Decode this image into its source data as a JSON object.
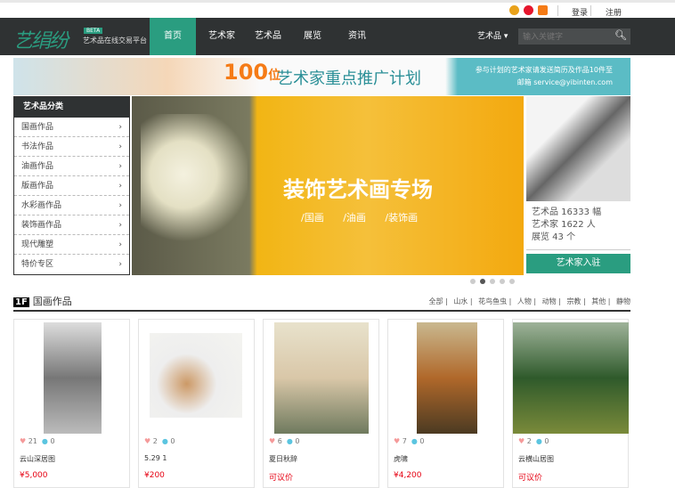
{
  "topbar": {
    "login": "登录",
    "register": "注册",
    "icons": [
      "qq-icon",
      "weibo-icon",
      "alipay-icon"
    ]
  },
  "nav": {
    "logo": "艺绢纷",
    "beta": "BETA",
    "slogan": "艺术品在线交易平台",
    "items": [
      "首页",
      "艺术家",
      "艺术品",
      "展览",
      "资讯"
    ],
    "search_type": "艺术品",
    "search_placeholder": "输入关键字"
  },
  "banner": {
    "num": "100",
    "unit": "位",
    "title": "艺术家重点推广计划",
    "line1": "参与计划的艺术家请发送简历及作品10件至",
    "line2": "邮箱 service@yibinten.com"
  },
  "categories": {
    "title": "艺术品分类",
    "items": [
      "国画作品",
      "书法作品",
      "油画作品",
      "版画作品",
      "水彩画作品",
      "装饰画作品",
      "现代雕塑",
      "特价专区"
    ]
  },
  "slider": {
    "title": "装饰艺术画专场",
    "tags": "/国画 /油画 /装饰画",
    "slides": 5,
    "active": 2
  },
  "stats": {
    "artworks": "艺术品 16333 幅",
    "artists": "艺术家 1622 人",
    "exhibitions": "展览 43 个",
    "join": "艺术家入驻"
  },
  "floor": {
    "badge": "1F",
    "title": "国画作品",
    "tabs": [
      "全部",
      "山水",
      "花鸟鱼虫",
      "人物",
      "动物",
      "宗教",
      "其他",
      "静物"
    ]
  },
  "products": [
    {
      "likes": "21",
      "comments": "0",
      "name": "云山深居图",
      "price": "¥5,000"
    },
    {
      "likes": "2",
      "comments": "0",
      "name": "5.29  1",
      "price": "¥200"
    },
    {
      "likes": "6",
      "comments": "0",
      "name": "夏日秋辞",
      "price": "可议价"
    },
    {
      "likes": "7",
      "comments": "0",
      "name": "虎啸",
      "price": "¥4,200"
    },
    {
      "likes": "2",
      "comments": "0",
      "name": "云横山居图",
      "price": "可议价"
    }
  ]
}
